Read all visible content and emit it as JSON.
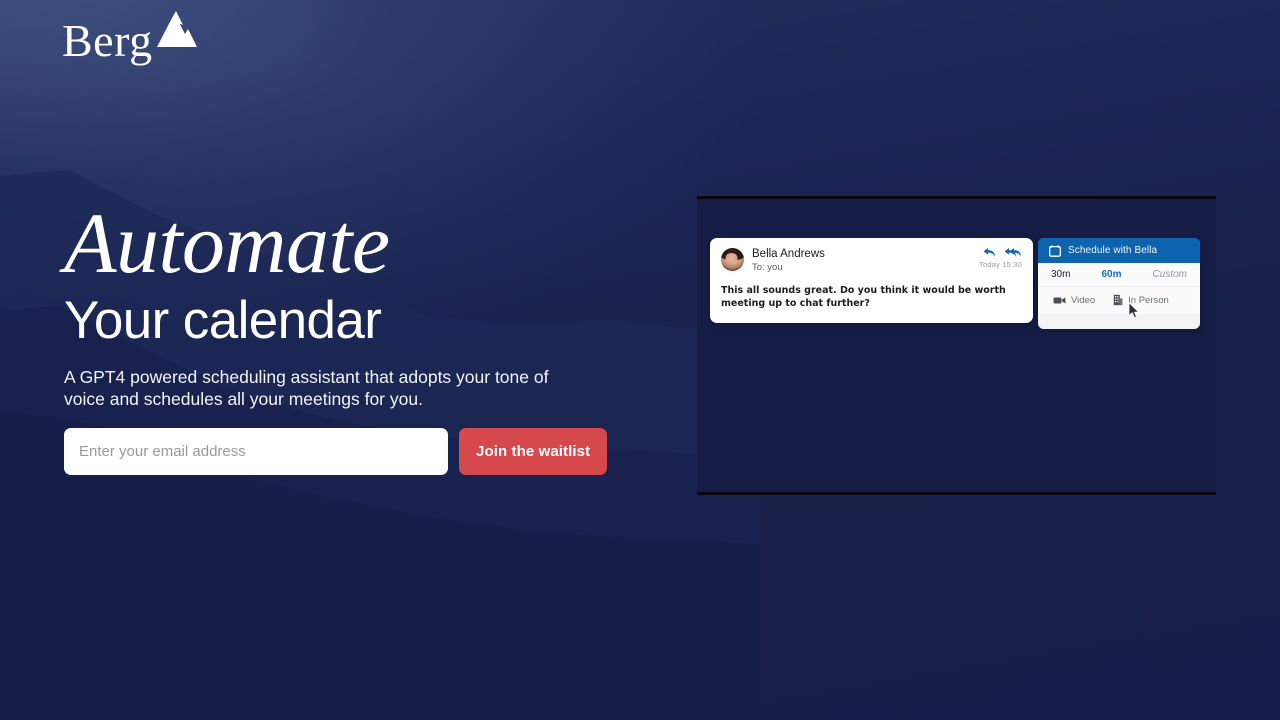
{
  "brand": {
    "name": "Berg",
    "mark_icon": "mountain-peak-icon"
  },
  "hero": {
    "headline_italic": "Automate",
    "headline_plain": "Your calendar",
    "subtitle": "A GPT4 powered scheduling assistant that adopts your tone of voice and schedules all your meetings for you."
  },
  "signup": {
    "email_placeholder": "Enter your email address",
    "email_value": "",
    "cta_label": "Join the waitlist",
    "cta_color": "#d5484c"
  },
  "demo": {
    "email_card": {
      "sender": "Bella Andrews",
      "recipient": "To: you",
      "timestamp": "Today 15:30",
      "body": "This all sounds great. Do you think it would be worth meeting up to chat further?",
      "reply_icon": "reply-arrow-icon",
      "reply_all_icon": "reply-all-arrow-icon",
      "avatar_icon": "avatar"
    },
    "scheduler": {
      "header_title": "Schedule with Bella",
      "header_icon": "calendar-icon",
      "header_color": "#0b64ad",
      "durations": [
        {
          "label": "30m",
          "state": "default"
        },
        {
          "label": "60m",
          "state": "selected"
        },
        {
          "label": "Custom",
          "state": "muted"
        }
      ],
      "selected_color": "#0b6fc4",
      "modes": [
        {
          "label": "Video",
          "icon": "video-camera-icon"
        },
        {
          "label": "In Person",
          "icon": "office-building-icon"
        }
      ]
    },
    "cursor_icon": "mouse-pointer-icon"
  },
  "theme": {
    "background": "#161e4b",
    "text": "#ffffff"
  }
}
